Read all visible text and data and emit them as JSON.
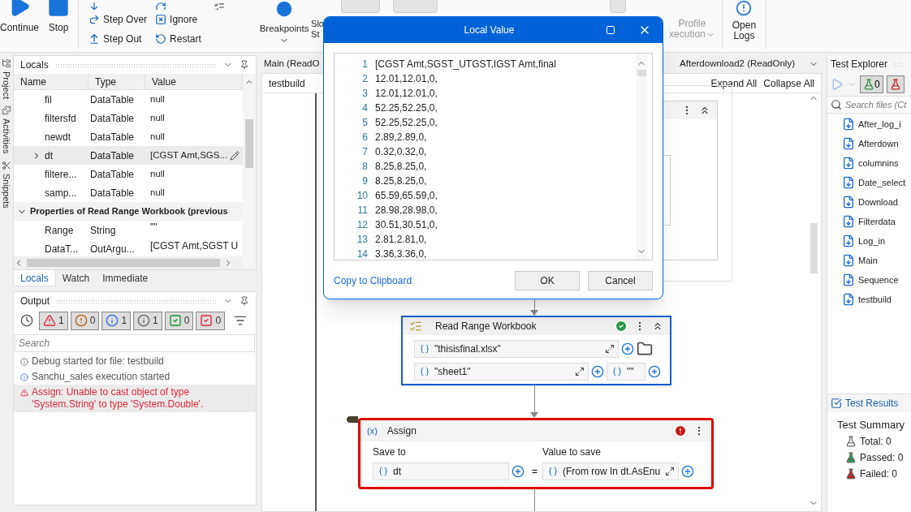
{
  "ribbon": {
    "large_buttons": [
      {
        "label": "Continue",
        "kind": "play"
      },
      {
        "label": "Stop",
        "kind": "stop"
      }
    ],
    "step_buttons": [
      {
        "label": "Step Over",
        "kind": "step-over"
      },
      {
        "label": "Step Out",
        "kind": "step-out"
      }
    ],
    "retry_buttons": [
      {
        "label": "Ignore",
        "kind": "ignore"
      },
      {
        "label": "Restart",
        "kind": "restart"
      }
    ],
    "breakpoints_button": {
      "label": "Breakpoints"
    },
    "slow_step_button": {
      "lines": [
        "Slo",
        "St"
      ]
    },
    "profile_button": {
      "lines": [
        "Profile",
        "xecution"
      ]
    },
    "open_logs_button": {
      "lines": [
        "Open",
        "Logs"
      ]
    }
  },
  "side_strip": [
    "Project",
    "Activities",
    "Snippets"
  ],
  "locals": {
    "title": "Locals",
    "columns": [
      "Name",
      "Type",
      "Value"
    ],
    "rows": [
      {
        "name": "fil",
        "type": "DataTable",
        "value": "null",
        "expandable": false,
        "selected": false
      },
      {
        "name": "filtersfd",
        "type": "DataTable",
        "value": "null",
        "expandable": false,
        "selected": false
      },
      {
        "name": "newdt",
        "type": "DataTable",
        "value": "null",
        "expandable": false,
        "selected": false
      },
      {
        "name": "dt",
        "type": "DataTable",
        "value": "[CGST Amt,SGS...",
        "expandable": true,
        "selected": true
      },
      {
        "name": "filtere...",
        "type": "DataTable",
        "value": "null",
        "expandable": false,
        "selected": false
      },
      {
        "name": "samp...",
        "type": "DataTable",
        "value": "null",
        "expandable": false,
        "selected": false
      }
    ],
    "group": {
      "title": "Properties of Read Range Workbook (previous",
      "expanded": true,
      "rows": [
        {
          "name": "Range",
          "type": "String",
          "value": "\"\""
        },
        {
          "name": "DataT...",
          "type": "OutArgu...",
          "value": "[CGST Amt,SGST U"
        }
      ]
    },
    "tabs": [
      {
        "label": "Locals",
        "selected": true
      },
      {
        "label": "Watch",
        "selected": false
      },
      {
        "label": "Immediate",
        "selected": false
      }
    ]
  },
  "output": {
    "title": "Output",
    "filters": [
      {
        "kind": "error",
        "count": "1",
        "selected": true
      },
      {
        "kind": "warning",
        "count": "0",
        "selected": true
      },
      {
        "kind": "info",
        "count": "1",
        "selected": true
      },
      {
        "kind": "trace",
        "count": "1",
        "selected": true
      },
      {
        "kind": "success",
        "count": "0",
        "selected": true
      },
      {
        "kind": "fail",
        "count": "0",
        "selected": true
      }
    ],
    "search": {
      "placeholder": "Search"
    },
    "entries": [
      {
        "kind": "trace",
        "text": "Debug started for file: testbuild",
        "selected": false
      },
      {
        "kind": "info",
        "text": "Sanchu_sales execution started",
        "selected": false
      },
      {
        "kind": "error",
        "text": "Assign: Unable to cast object of type 'System.String' to type 'System.Double'.",
        "selected": true
      }
    ]
  },
  "designer": {
    "tabs": [
      {
        "label": "Main (ReadO"
      },
      {
        "label": "Afterdownload2 (ReadOnly)"
      }
    ],
    "breadcrumb": "testbuild",
    "expand_all": "Expand All",
    "collapse_all": "Collapse All",
    "read_range": {
      "title": "Read Range Workbook",
      "valid": true,
      "selected": true,
      "path": "\"thisisfinal.xlsx\"",
      "sheet": "\"sheet1\"",
      "range": "\"\""
    },
    "assign": {
      "title": "Assign",
      "icon_text": "(x)",
      "equals": "=",
      "error": true,
      "save_to_label": "Save to",
      "value_label": "Value to save",
      "save_to": "dt",
      "value": "(From row In dt.AsEnu"
    }
  },
  "dialog": {
    "title": "Local Value",
    "lines": [
      "[CGST Amt,SGST_UTGST,IGST Amt,final",
      "12.01,12.01,0,",
      "12.01,12.01,0,",
      "52.25,52.25,0,",
      "52.25,52.25,0,",
      "2.89,2.89,0,",
      "0.32,0.32,0,",
      "8.25,8.25,0,",
      "8.25,8.25,0,",
      "65.59,65.59,0,",
      "28.98,28.98,0,",
      "30.51,30.51,0,",
      "2.81,2.81,0,",
      "3.36,3.36,0,"
    ],
    "line_numbers": [
      "1",
      "2",
      "3",
      "4",
      "5",
      "6",
      "7",
      "8",
      "9",
      "10",
      "11",
      "12",
      "13",
      "14"
    ],
    "link": "Copy to Clipboard",
    "buttons": [
      "OK",
      "Cancel"
    ]
  },
  "test_explorer": {
    "title": "Test Explorer",
    "filters": [
      {
        "kind": "passed",
        "count": "0"
      },
      {
        "kind": "failed"
      }
    ],
    "search": {
      "placeholder": "Search files (Ct"
    },
    "files": [
      "After_log_i",
      "Afterdown",
      "columnins",
      "Date_select",
      "Download",
      "Filterdata",
      "Log_in",
      "Main",
      "Sequence",
      "testbuild"
    ],
    "results_tab": "Test Results",
    "summary_title": "Test Summary",
    "summary": [
      {
        "kind": "total",
        "text": "Total: 0"
      },
      {
        "kind": "passed",
        "text": "Passed: 0"
      },
      {
        "kind": "failed",
        "text": "Failed: 0"
      }
    ]
  }
}
